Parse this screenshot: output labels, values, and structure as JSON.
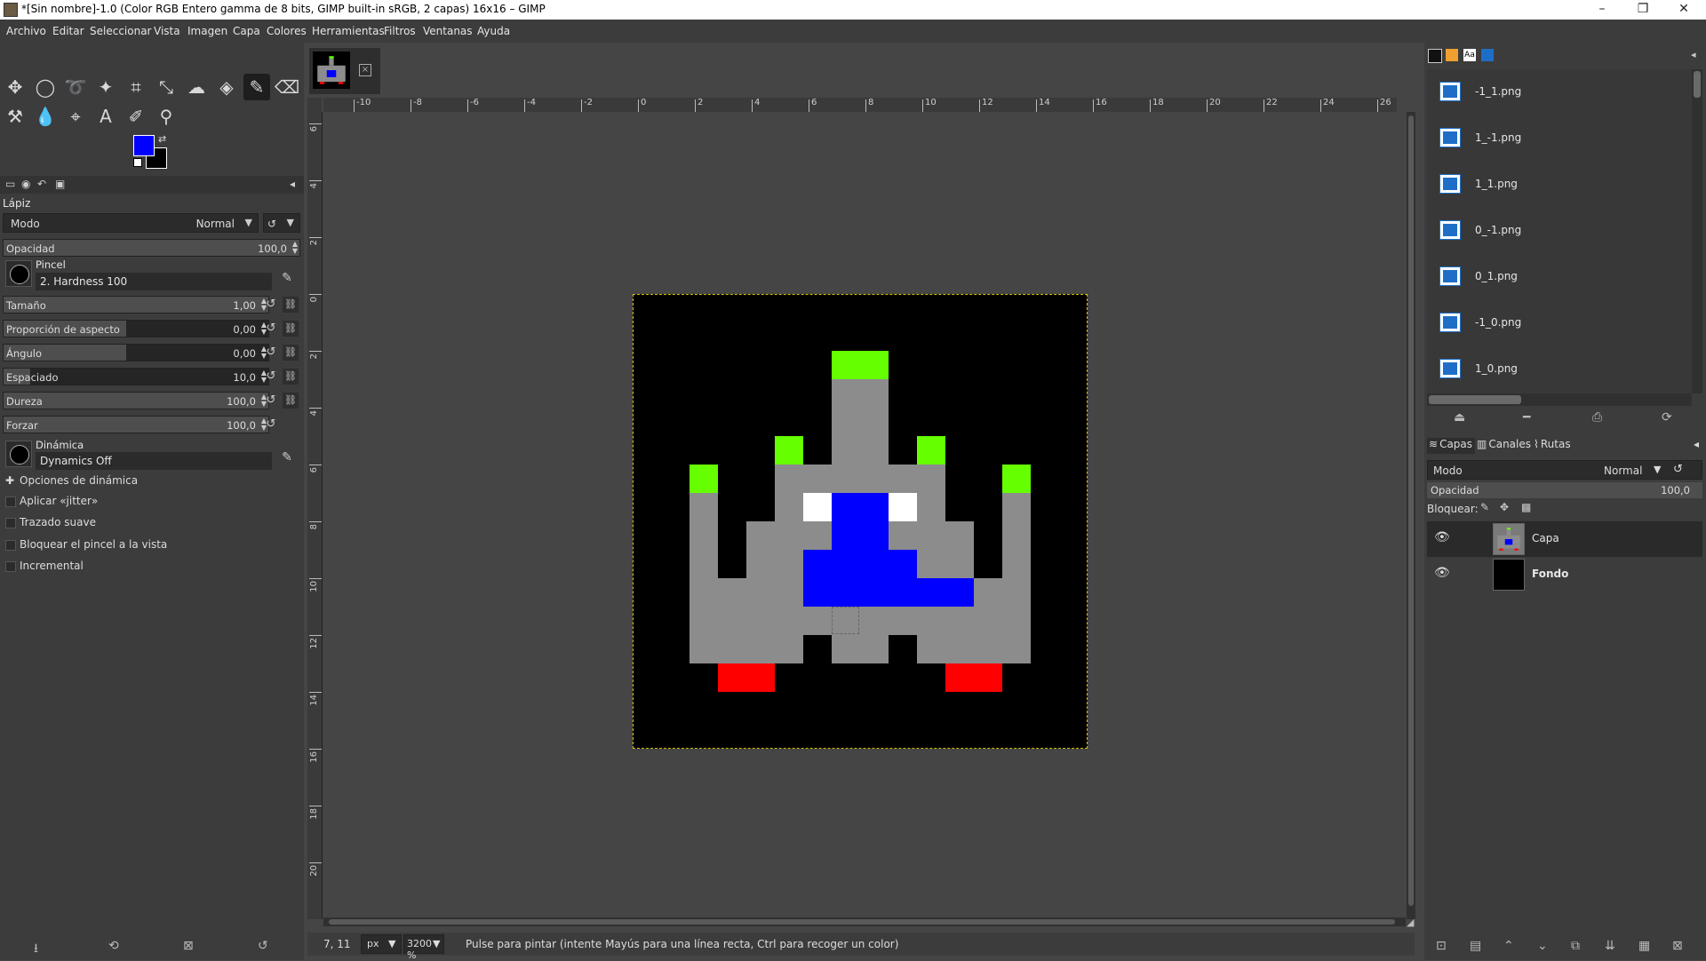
{
  "window": {
    "title": "*[Sin nombre]-1.0 (Color RGB Entero gamma de 8 bits, GIMP built-in sRGB, 2 capas) 16x16 – GIMP",
    "minimize": "–",
    "maximize": "❐",
    "close": "✕"
  },
  "menu": [
    "Archivo",
    "Editar",
    "Seleccionar",
    "Vista",
    "Imagen",
    "Capa",
    "Colores",
    "Herramientas",
    "Filtros",
    "Ventanas",
    "Ayuda"
  ],
  "colors": {
    "foreground": "#0000ff",
    "background": "#000000",
    "accent": "#d4c000"
  },
  "tool_options": {
    "tool_name": "Lápiz",
    "mode_label": "Modo",
    "mode_value": "Normal",
    "opacity": {
      "label": "Opacidad",
      "value": "100,0"
    },
    "brush_label": "Pincel",
    "brush_value": "2. Hardness 100",
    "size": {
      "label": "Tamaño",
      "value": "1,00"
    },
    "aspect": {
      "label": "Proporción de aspecto",
      "value": "0,00"
    },
    "angle": {
      "label": "Ángulo",
      "value": "0,00"
    },
    "spacing": {
      "label": "Espaciado",
      "value": "10,0"
    },
    "hardness": {
      "label": "Dureza",
      "value": "100,0"
    },
    "force": {
      "label": "Forzar",
      "value": "100,0"
    },
    "dynamics_label": "Dinámica",
    "dynamics_value": "Dynamics Off",
    "options": [
      "Opciones de dinámica",
      "Aplicar «jitter»",
      "Trazado suave",
      "Bloquear el pincel a la vista",
      "Incremental"
    ]
  },
  "rulers": {
    "h_labels": [
      "-10",
      "-8",
      "-6",
      "-4",
      "-2",
      "0",
      "2",
      "4",
      "6",
      "8",
      "10",
      "12",
      "14",
      "16",
      "18",
      "20",
      "22",
      "24",
      "26"
    ],
    "v_labels": [
      "6",
      "4",
      "2",
      "0",
      "2",
      "4",
      "6",
      "8",
      "10",
      "12",
      "14",
      "16",
      "18",
      "20"
    ]
  },
  "image": {
    "palette": {
      "k": "#000000",
      "g": "#8c8c8c",
      "G": "#66ff00",
      "B": "#0000ff",
      "W": "#ffffff",
      "R": "#ff0000"
    },
    "pixels": [
      "kkkkkkkkkkkkkkkk",
      "kkkkkkkkkkkkkkkk",
      "kkkkkkkGGkkkkkkk",
      "kkkkkkkggkkkkkkk",
      "kkkkkkkggkkkkkkk",
      "kkkkkGkggkGkkkkk",
      "kkGkkggggggkkGkk",
      "kkgkkgWBBWgkkgkk",
      "kkgkgggBBgggkgkk",
      "kkgkggBBBBggkgkk",
      "kkggggBBBBBBggkk",
      "kkggggggggggggkk",
      "kkggggkggkggggkk",
      "kkkRRkkkkkkRRkkk",
      "kkkkkkkkkkkkkkkk",
      "kkkkkkkkkkkkkkkk"
    ]
  },
  "status": {
    "coords": "7, 11",
    "unit": "px",
    "zoom": "3200 %",
    "message": "Pulse para pintar (intente Mayús para una línea recta, Ctrl para recoger un color)"
  },
  "images_panel": [
    "-1_1.png",
    "1_-1.png",
    "1_1.png",
    "0_-1.png",
    "0_1.png",
    "-1_0.png",
    "1_0.png"
  ],
  "layers_panel": {
    "tabs": [
      "Capas",
      "Canales",
      "Rutas"
    ],
    "mode_label": "Modo",
    "mode_value": "Normal",
    "opacity_label": "Opacidad",
    "opacity_value": "100,0",
    "lock_label": "Bloquear:",
    "layers": [
      "Capa",
      "Fondo"
    ]
  }
}
